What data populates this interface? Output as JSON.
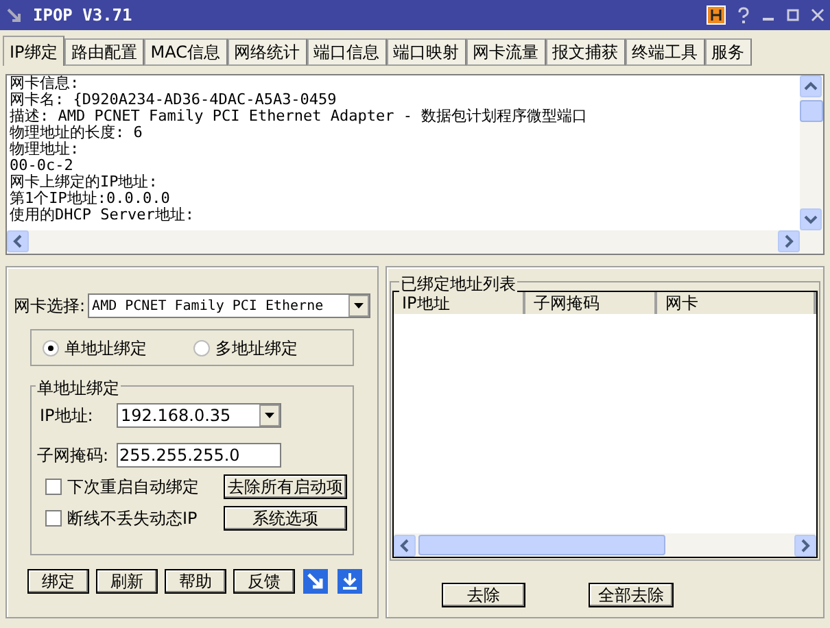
{
  "window": {
    "title": "IPOP V3.71"
  },
  "tabs": [
    {
      "label": "IP绑定",
      "selected": true
    },
    {
      "label": "路由配置",
      "selected": false
    },
    {
      "label": "MAC信息",
      "selected": false
    },
    {
      "label": "网络统计",
      "selected": false
    },
    {
      "label": "端口信息",
      "selected": false
    },
    {
      "label": "端口映射",
      "selected": false
    },
    {
      "label": "网卡流量",
      "selected": false
    },
    {
      "label": "报文捕获",
      "selected": false
    },
    {
      "label": "终端工具",
      "selected": false
    },
    {
      "label": "服务",
      "selected": false
    }
  ],
  "info_lines": [
    "网卡信息:",
    "网卡名: {D920A234-AD36-4DAC-A5A3-0459",
    "描述: AMD PCNET Family PCI Ethernet Adapter - 数据包计划程序微型端口",
    "物理地址的长度: 6",
    "物理地址:",
    "00-0c-2",
    "网卡上绑定的IP地址:",
    "第1个IP地址:0.0.0.0",
    "使用的DHCP Server地址:"
  ],
  "nic_select": {
    "label": "网卡选择:",
    "value": "AMD PCNET Family PCI Etherne"
  },
  "bind_mode": [
    {
      "label": "单地址绑定",
      "selected": true
    },
    {
      "label": "多地址绑定",
      "selected": false
    }
  ],
  "single_bind": {
    "title": "单地址绑定",
    "ip_label": "IP地址:",
    "ip_value": "192.168.0.35",
    "mask_label": "子网掩码:",
    "mask_value": "255.255.255.0",
    "options": [
      {
        "label": "下次重启自动绑定",
        "checked": false,
        "button": "去除所有启动项"
      },
      {
        "label": "断线不丢失动态IP",
        "checked": false,
        "button": "系统选项"
      }
    ]
  },
  "footer_buttons": [
    "绑定",
    "刷新",
    "帮助",
    "反馈"
  ],
  "bound_list": {
    "title": "已绑定地址列表",
    "columns": [
      "IP地址",
      "子网掩码",
      "网卡"
    ],
    "buttons": [
      "去除",
      "全部去除"
    ]
  }
}
